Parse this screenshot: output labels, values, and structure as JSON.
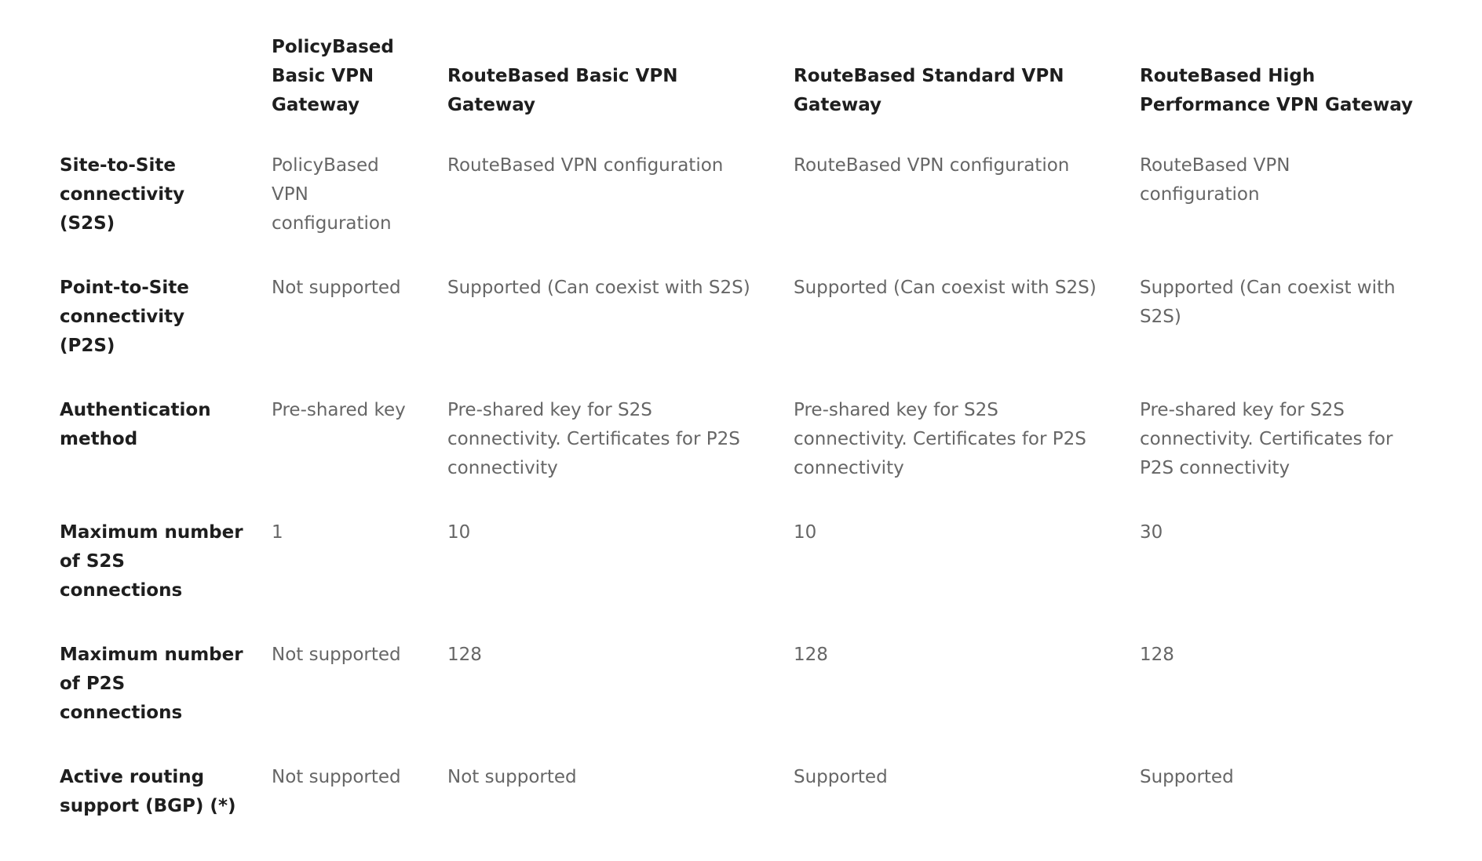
{
  "table": {
    "columns": [
      "",
      "PolicyBased Basic VPN Gateway",
      "RouteBased Basic VPN Gateway",
      "RouteBased Standard VPN Gateway",
      "RouteBased High Performance VPN Gateway"
    ],
    "rows": [
      {
        "label": "Site-to-Site connectivity (S2S)",
        "cells": [
          "PolicyBased VPN configuration",
          "RouteBased VPN configuration",
          "RouteBased VPN configuration",
          "RouteBased VPN configuration"
        ]
      },
      {
        "label": "Point-to-Site connectivity (P2S)",
        "cells": [
          "Not supported",
          "Supported (Can coexist with S2S)",
          "Supported (Can coexist with S2S)",
          "Supported (Can coexist with S2S)"
        ]
      },
      {
        "label": "Authentication method",
        "cells": [
          "Pre-shared key",
          "Pre-shared key for S2S connectivity. Certificates for P2S connectivity",
          "Pre-shared key for S2S connectivity. Certificates for P2S connectivity",
          "Pre-shared key for S2S connectivity. Certificates for P2S connectivity"
        ]
      },
      {
        "label": "Maximum number of S2S connections",
        "cells": [
          "1",
          "10",
          "10",
          "30"
        ]
      },
      {
        "label": "Maximum number of P2S connections",
        "cells": [
          "Not supported",
          "128",
          "128",
          "128"
        ]
      },
      {
        "label": "Active routing support (BGP) (*)",
        "cells": [
          "Not supported",
          "Not supported",
          "Supported",
          "Supported"
        ]
      }
    ]
  }
}
